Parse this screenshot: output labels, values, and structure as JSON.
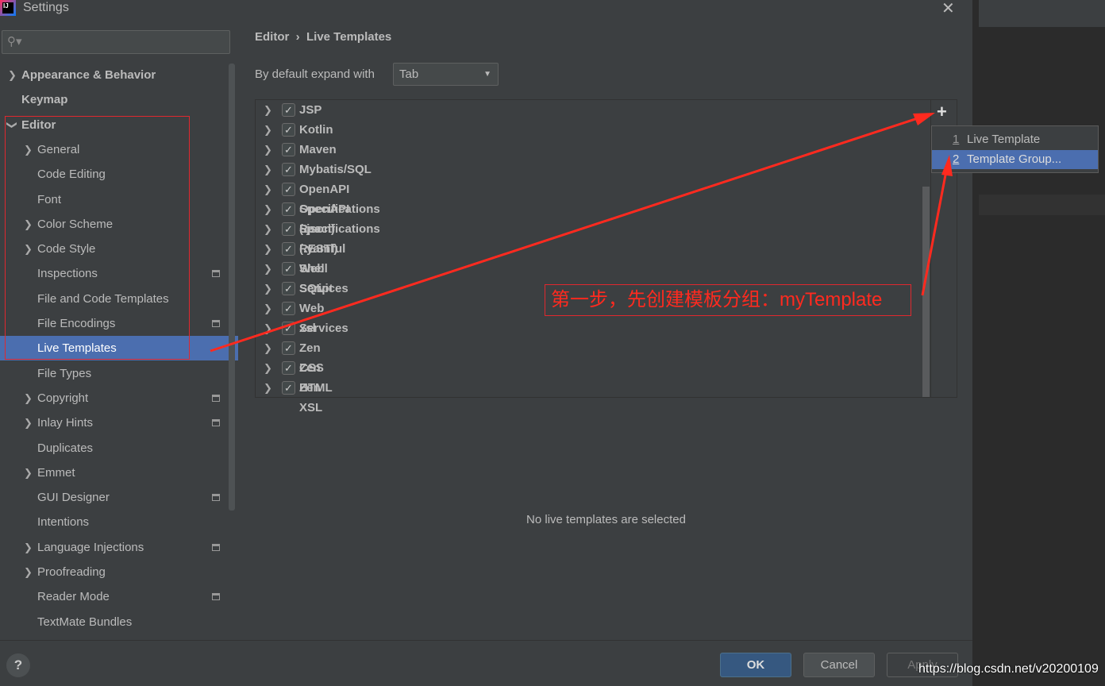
{
  "window": {
    "title": "Settings",
    "close": "✕"
  },
  "search": {
    "placeholder": "",
    "icon": "search-icon"
  },
  "sidebar": {
    "items": [
      {
        "label": "Appearance & Behavior",
        "chev": "›",
        "level": 0,
        "bold": true
      },
      {
        "label": "Keymap",
        "level": 0,
        "bold": true
      },
      {
        "label": "Editor",
        "chev": "⌄",
        "level": 0,
        "bold": true
      },
      {
        "label": "General",
        "chev": "›",
        "level": 1
      },
      {
        "label": "Code Editing",
        "level": 1
      },
      {
        "label": "Font",
        "level": 1
      },
      {
        "label": "Color Scheme",
        "chev": "›",
        "level": 1
      },
      {
        "label": "Code Style",
        "chev": "›",
        "level": 1
      },
      {
        "label": "Inspections",
        "level": 1,
        "badge": true
      },
      {
        "label": "File and Code Templates",
        "level": 1
      },
      {
        "label": "File Encodings",
        "level": 1,
        "badge": true
      },
      {
        "label": "Live Templates",
        "level": 1,
        "selected": true
      },
      {
        "label": "File Types",
        "level": 1
      },
      {
        "label": "Copyright",
        "chev": "›",
        "level": 1,
        "badge": true
      },
      {
        "label": "Inlay Hints",
        "chev": "›",
        "level": 1,
        "badge": true
      },
      {
        "label": "Duplicates",
        "level": 1
      },
      {
        "label": "Emmet",
        "chev": "›",
        "level": 1
      },
      {
        "label": "GUI Designer",
        "level": 1,
        "badge": true
      },
      {
        "label": "Intentions",
        "level": 1
      },
      {
        "label": "Language Injections",
        "chev": "›",
        "level": 1,
        "badge": true
      },
      {
        "label": "Proofreading",
        "chev": "›",
        "level": 1
      },
      {
        "label": "Reader Mode",
        "level": 1,
        "badge": true
      },
      {
        "label": "TextMate Bundles",
        "level": 1
      }
    ]
  },
  "breadcrumb": {
    "text": "Editor  ›  Live Templates"
  },
  "expand": {
    "label": "By default expand with",
    "value": "Tab"
  },
  "templates": [
    "JSP",
    "Kotlin",
    "Maven",
    "Mybatis/SQL",
    "OpenAPI Specifications (.json)",
    "OpenAPI Specifications (.yaml)",
    "React",
    "RESTful Web Services",
    "Shell Script",
    "SQL",
    "Web Services",
    "xsl",
    "Zen CSS",
    "Zen HTML",
    "Zen XSL"
  ],
  "add_menu": {
    "plus": "+",
    "items": [
      {
        "num": "1",
        "label": "Live Template"
      },
      {
        "num": "2",
        "label": "Template Group...",
        "selected": true
      }
    ]
  },
  "empty_message": "No live templates are selected",
  "annotation": "第一步，先创建模板分组：myTemplate",
  "buttons": {
    "help": "?",
    "ok": "OK",
    "cancel": "Cancel",
    "apply": "Apply"
  },
  "watermark": "https://blog.csdn.net/v20200109",
  "colors": {
    "selection": "#4b6eaf",
    "annotation": "#e0282e",
    "ok": "#365880"
  }
}
